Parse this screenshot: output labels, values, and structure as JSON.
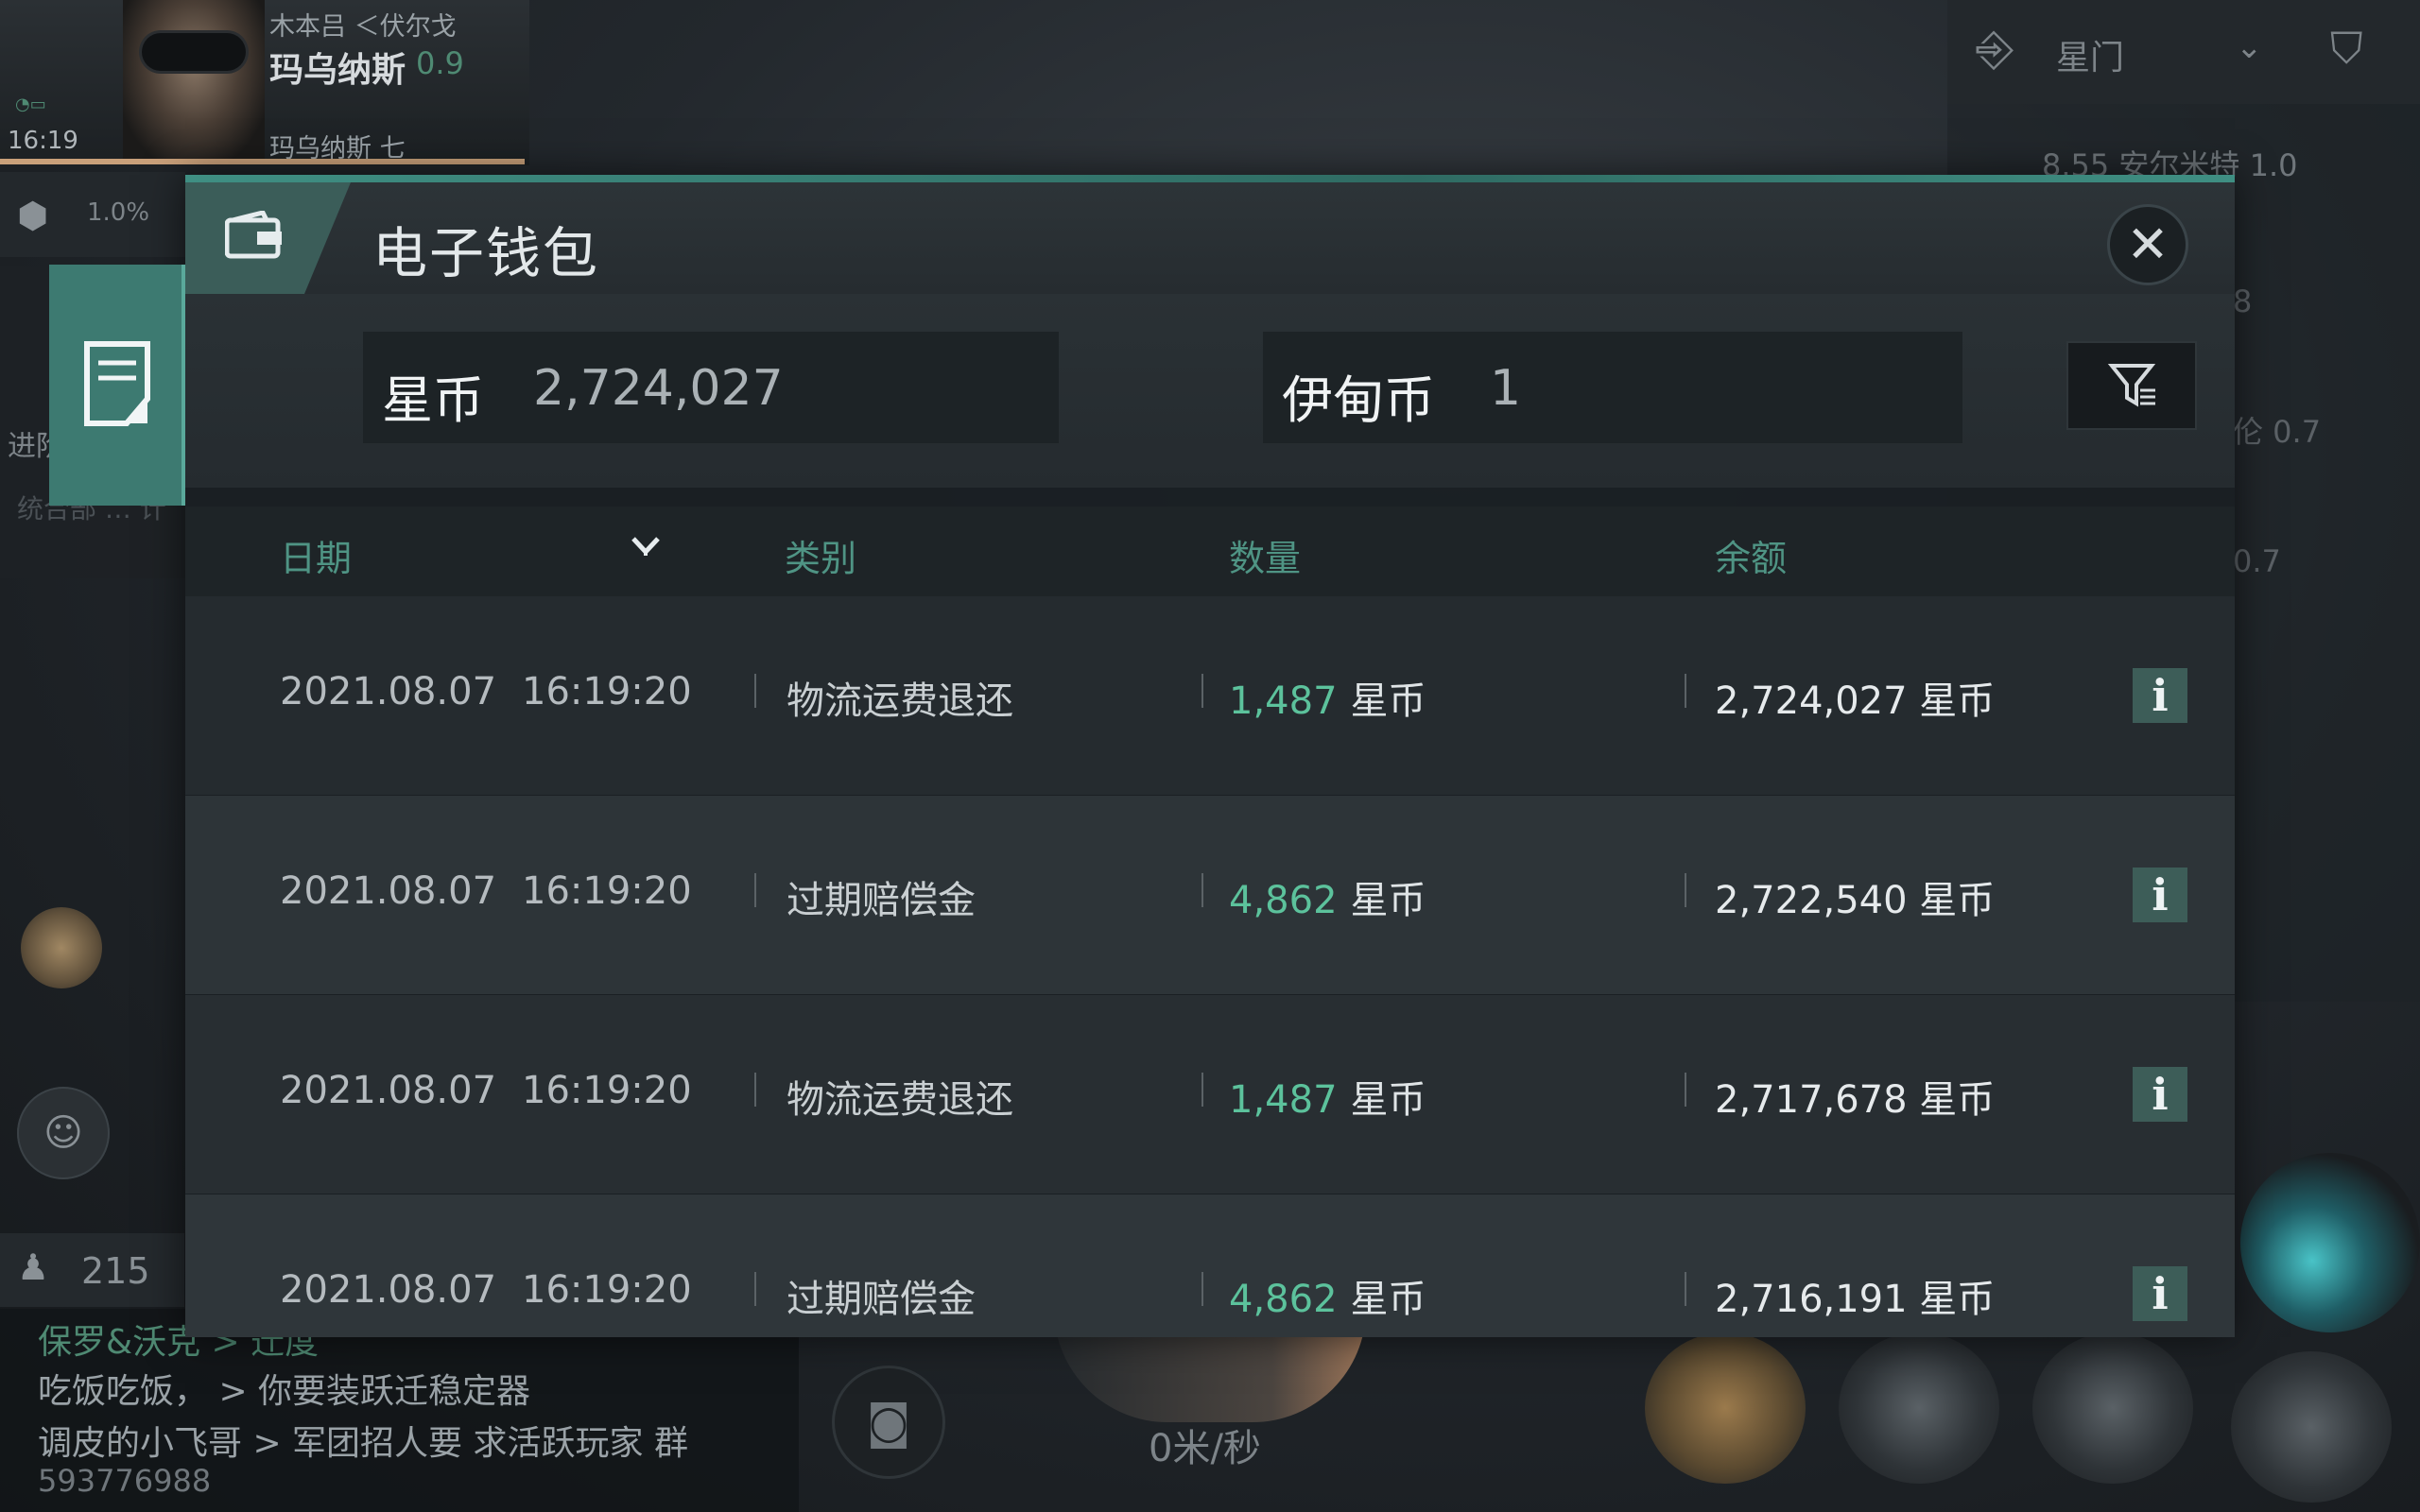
{
  "hud": {
    "location_top": "木本吕 ＜伏尔戈",
    "system_name": "玛乌纳斯",
    "security": "0.9",
    "station": "玛乌纳斯 七",
    "clock": "16:19",
    "cargo_pct": "1.0%",
    "side_text_1": "进阶",
    "side_text_2": "统合部 … 计",
    "online_count": "215",
    "speed": "0米/秒"
  },
  "chat": {
    "line1": "保罗&沃克 > 迁度",
    "line2": "吃饭吃饭， > 你要装跃迁稳定器",
    "line3": "调皮的小飞哥 > 军团招人要 求活跃玩家 群",
    "line4": "593776988"
  },
  "overview": {
    "filter_label": "星门",
    "row1": "8.55 安尔米特 1.0",
    "row2": "8",
    "row3": "伦 0.7",
    "row4": "0.7"
  },
  "wallet": {
    "title": "电子钱包",
    "star_label": "星币",
    "star_value": "2,724,027",
    "eden_label": "伊甸币",
    "eden_value": "1",
    "columns": {
      "date": "日期",
      "category": "类别",
      "amount": "数量",
      "balance": "余额"
    },
    "rows": [
      {
        "date": "2021.08.07",
        "time": "16:19:20",
        "category": "物流运费退还",
        "amount": "1,487",
        "amount_unit": "星币",
        "balance": "2,724,027 星币"
      },
      {
        "date": "2021.08.07",
        "time": "16:19:20",
        "category": "过期赔偿金",
        "amount": "4,862",
        "amount_unit": "星币",
        "balance": "2,722,540 星币"
      },
      {
        "date": "2021.08.07",
        "time": "16:19:20",
        "category": "物流运费退还",
        "amount": "1,487",
        "amount_unit": "星币",
        "balance": "2,717,678 星币"
      },
      {
        "date": "2021.08.07",
        "time": "16:19:20",
        "category": "过期赔偿金",
        "amount": "4,862",
        "amount_unit": "星币",
        "balance": "2,716,191 星币"
      }
    ],
    "info_glyph": "i"
  },
  "colors": {
    "accent": "#3d7a71",
    "positive": "#5cc29c",
    "header_text": "#4f9484"
  }
}
